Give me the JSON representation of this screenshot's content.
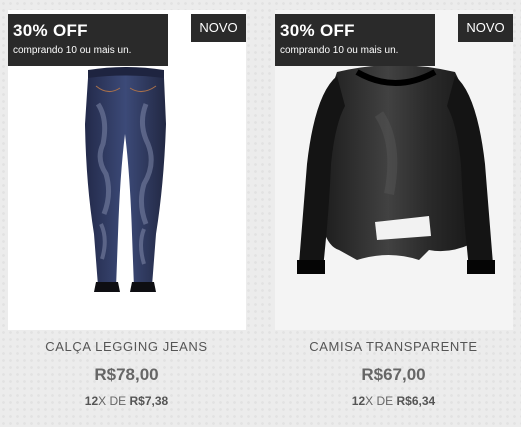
{
  "products": [
    {
      "promo_title": "30% OFF",
      "promo_subtitle": "comprando 10 ou mais un.",
      "badge": "NOVO",
      "name": "CALÇA LEGGING JEANS",
      "price": "R$78,00",
      "installments_count": "12",
      "installments_label": "X DE",
      "installment_value": "R$7,38",
      "image": "jeans-legging-image"
    },
    {
      "promo_title": "30% OFF",
      "promo_subtitle": "comprando 10 ou mais un.",
      "badge": "NOVO",
      "name": "CAMISA TRANSPARENTE",
      "price": "R$67,00",
      "installments_count": "12",
      "installments_label": "X DE",
      "installment_value": "R$6,34",
      "image": "sheer-blouse-image"
    }
  ]
}
